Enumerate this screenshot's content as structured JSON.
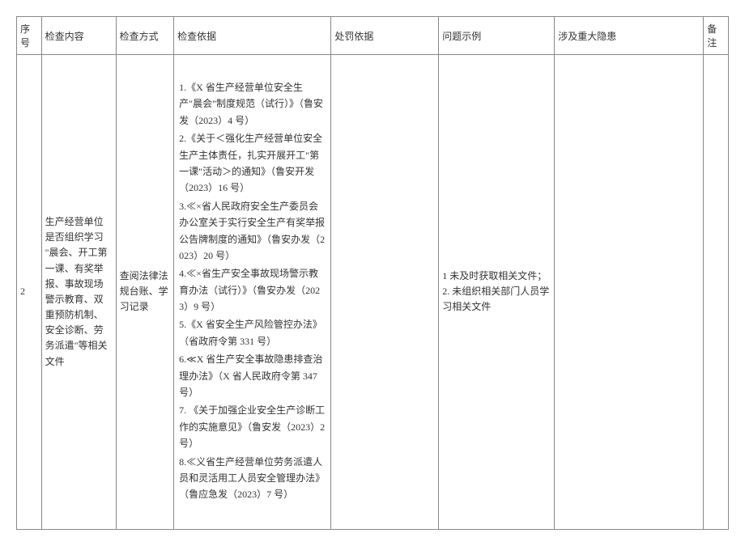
{
  "headers": {
    "seq": "序号",
    "content": "检查内容",
    "method": "检查方式",
    "basis": "检查依据",
    "penalty": "处罚依据",
    "example": "问题示例",
    "hazard": "涉及重大隐患",
    "remark": "备注"
  },
  "row": {
    "seq": "2",
    "content": "生产经营单位是否组织学习\n\"晨会、开工第一课、有奖举报、事故现场警示教育、双重预防机制、安全诊断、劳务派遣\"等相关文件",
    "method": "查阅法律法规台账、学习记录",
    "basis_items": [
      "1.《X 省生产经营单位安全生产\"晨会\"制度规范（试行）》（鲁安发（2023）4 号）",
      "2.《关于＜强化生产经营单位安全生产主体责任，扎实开展开工\"第一课\"活动＞的通知》（鲁安开发（2023）16 号）",
      "3.≪×省人民政府安全生产委员会办公室关于实行安全生产有奖举报公告牌制度的通知》（鲁安办发（2023）20 号）",
      "4.≪×省生产安全事故现场警示教育办法（试行）》（鲁安办发（2023）9 号）",
      "5.《X 省安全生产风险管控办法》（省政府令第 331 号）",
      "6.≪X 省生产安全事故隐患排查治理办法》（X 省人民政府令第 347 号）",
      "7. 《关于加强企业安全生产诊断工作的实施意见》（鲁安发（2023）2 号）",
      "8.≪义省生产经营单位劳务派遣人员和灵活用工人员安全管理办法》（鲁应急发（2023）7 号）"
    ],
    "penalty": "",
    "example": "1 未及时获取相关文件；\n2. 未组织相关部门人员学习相关文件",
    "hazard": "",
    "remark": ""
  }
}
